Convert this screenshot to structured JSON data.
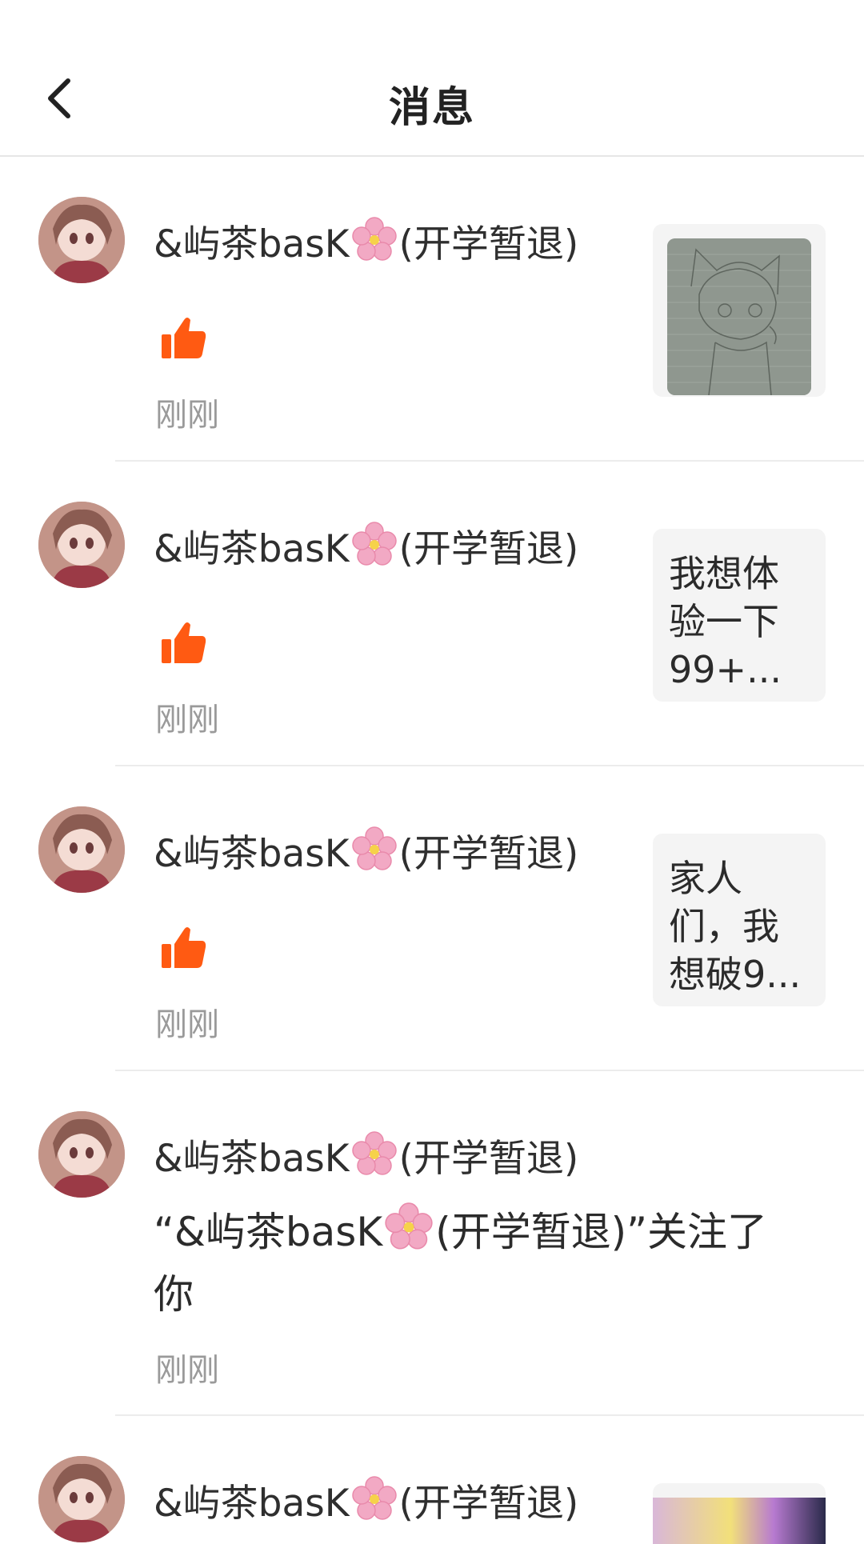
{
  "header": {
    "title": "消息",
    "back_icon": "chevron-left-icon"
  },
  "colors": {
    "accent": "#ff5a12",
    "muted": "#9a9a9a",
    "divider": "#ececec",
    "thumb_bg": "#f4f4f4"
  },
  "notifications": [
    {
      "user_prefix": "&屿茶basK",
      "user_suffix": "(开学暂退)",
      "type": "like",
      "time": "刚刚",
      "thumb": "sketch-image"
    },
    {
      "user_prefix": "&屿茶basK",
      "user_suffix": "(开学暂退)",
      "type": "like",
      "time": "刚刚",
      "thumb_text": "我想体验一下99+..."
    },
    {
      "user_prefix": "&屿茶basK",
      "user_suffix": "(开学暂退)",
      "type": "like",
      "time": "刚刚",
      "thumb_text": "家人们，我想破9..."
    },
    {
      "user_prefix": "&屿茶basK",
      "user_suffix": "(开学暂退)",
      "type": "follow",
      "message_prefix": "“&屿茶basK",
      "message_suffix": "(开学暂退)”关注了你",
      "time": "刚刚"
    },
    {
      "user_prefix": "&屿茶basK",
      "user_suffix": "(开学暂退)",
      "type": "like",
      "thumb": "colorful-image"
    }
  ]
}
